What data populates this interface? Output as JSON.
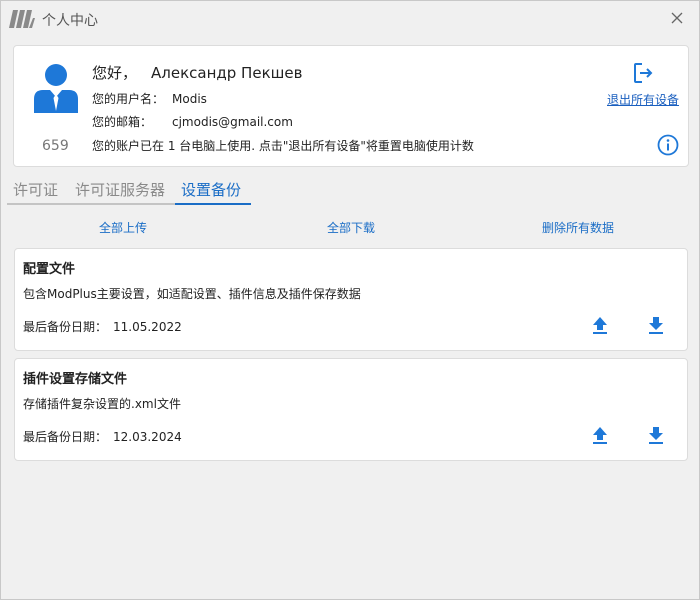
{
  "window": {
    "title": "个人中心",
    "colors": {
      "accent": "#1a6dc6",
      "avatar": "#1e78d8",
      "link": "#1a5fbf"
    }
  },
  "profile": {
    "greeting": "您好，",
    "name": "Александр Пекшев",
    "username_label": "您的用户名：",
    "username": "Modis",
    "email_label": "您的邮箱：",
    "email": "cjmodis@gmail.com",
    "device_count": "659",
    "usage_text": "您的账户已在 1 台电脑上使用. 点击\"退出所有设备\"将重置电脑使用计数",
    "logout_all_label": "退出所有设备"
  },
  "tabs": [
    {
      "label": "许可证",
      "active": false
    },
    {
      "label": "许可证服务器",
      "active": false
    },
    {
      "label": "设置备份",
      "active": true
    }
  ],
  "actions": {
    "upload_all": "全部上传",
    "download_all": "全部下载",
    "delete_all": "删除所有数据"
  },
  "backups": [
    {
      "title": "配置文件",
      "description": "包含ModPlus主要设置，如适配设置、插件信息及插件保存数据",
      "date_label": "最后备份日期：",
      "date": "11.05.2022"
    },
    {
      "title": "插件设置存储文件",
      "description": "存储插件复杂设置的.xml文件",
      "date_label": "最后备份日期：",
      "date": "12.03.2024"
    }
  ],
  "icons": {
    "app": "modplus-logo-icon",
    "close": "close-icon",
    "user": "user-avatar-icon",
    "logout": "logout-icon",
    "info": "info-icon",
    "upload": "upload-icon",
    "download": "download-icon"
  }
}
